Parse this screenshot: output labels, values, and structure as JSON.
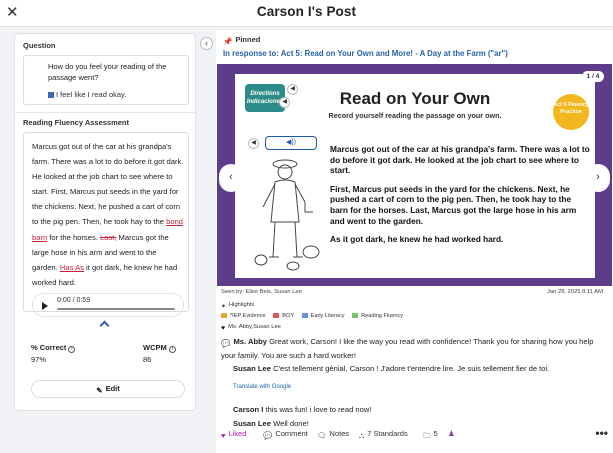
{
  "header": {
    "title": "Carson I's Post",
    "close_icon": "close-icon"
  },
  "question": {
    "label": "Question",
    "text": "How do you feel your reading of the passage went?",
    "answer": "I feel like I read okay."
  },
  "fluency": {
    "label": "Reading Fluency Assessment",
    "passage_a": "Marcus got out of the car at his grandpa's farm. There was a lot to do before it got dark. He looked at the job chart to see where to start. First, Marcus put seeds in the yard for the chickens. Next, he pushed a cart of corn to the pig pen. Then, he took hay to the ",
    "err1": "bond",
    "space1": " ",
    "err2": "barn",
    "passage_b": " for the horses. ",
    "err3": "Last,",
    "passage_c": " Marcus got the large hose in his arm and went to the garden. ",
    "err4": "Has As",
    "passage_d": " it got dark, he knew he had worked hard.",
    "player_time": "0:00 / 0:59"
  },
  "stats": {
    "correct_label": "% Correct",
    "correct_value": "97%",
    "wcpm_label": "WCPM",
    "wcpm_value": "86",
    "edit_label": "Edit"
  },
  "post": {
    "pinned": "Pinned",
    "response_to": "In response to: Act 5: Read on Your Own and More! - A Day at the Farm (\"ar\")",
    "slide": {
      "counter": "1 / 4",
      "title": "Read on Your Own",
      "subtitle": "Record yourself reading the passage on your own.",
      "directions_badge": "Directions Indicaciones",
      "act_badge": "Act 5 Fluency Practice",
      "paragraph1": "Marcus got out of the car at his grandpa's farm. There was a lot to do before it got dark. He looked at the job chart to see where to start.",
      "paragraph2": "First, Marcus put seeds in the yard for the chickens. Next, he pushed a cart of corn to the pig pen. Then, he took hay to the barn for the horses. Last, Marcus got the large hose in his arm and went to the garden.",
      "paragraph3": "As it got dark, he knew he had worked hard."
    },
    "seen_by": "Seen by: Elise Beis, Susan Lee",
    "date": "Jan 28, 2025 8:11 AM",
    "highlights_label": "Highlights",
    "tags": [
      {
        "label": "*IEP Evidence",
        "color": "#e8a33b"
      },
      {
        "label": "BOY",
        "color": "#e05757"
      },
      {
        "label": "Early Literacy",
        "color": "#6b8fd6"
      },
      {
        "label": "Reading Fluency",
        "color": "#7cc267"
      }
    ],
    "likes": "Ms. Abby,Susan Lee",
    "comments": [
      {
        "author": "Ms. Abby",
        "text": "Great work, Carson! I like the way you read with confidence! Thank you for sharing how you help your family. You are such a hard worker!"
      },
      {
        "author": "Susan Lee",
        "text": "C'est tellement génial, Carson ! J'adore t'entendre lire. Je suis tellement fier de toi."
      },
      {
        "author": "Carson I",
        "text": "this was fun! i love to read now!"
      },
      {
        "author": "Susan Lee",
        "text": "Well done!"
      }
    ],
    "translate_label": "Translate with Google",
    "actions": {
      "liked": "Liked",
      "comment": "Comment",
      "notes": "Notes",
      "standards": "7 Standards",
      "folders": "5"
    }
  }
}
